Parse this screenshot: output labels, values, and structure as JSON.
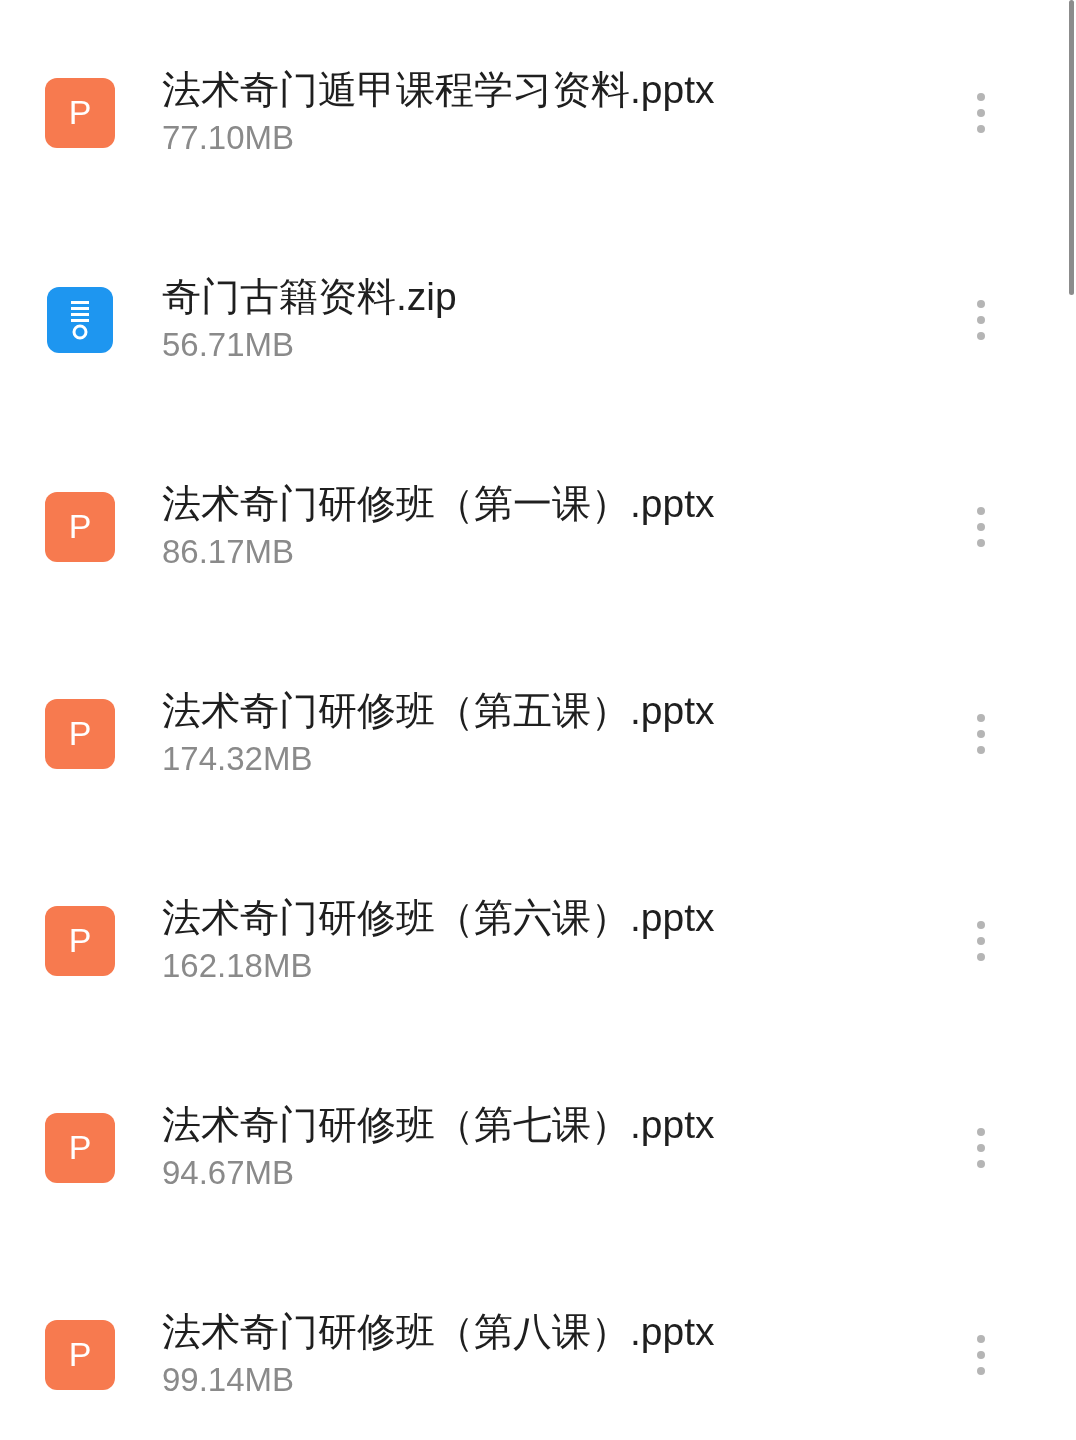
{
  "files": [
    {
      "kind": "pptx",
      "icon_letter": "P",
      "name": "法术奇门遁甲课程学习资料.pptx",
      "size": "77.10MB"
    },
    {
      "kind": "zip",
      "name": "奇门古籍资料.zip",
      "size": "56.71MB"
    },
    {
      "kind": "pptx",
      "icon_letter": "P",
      "name": "法术奇门研修班（第一课）.pptx",
      "size": "86.17MB"
    },
    {
      "kind": "pptx",
      "icon_letter": "P",
      "name": "法术奇门研修班（第五课）.pptx",
      "size": "174.32MB"
    },
    {
      "kind": "pptx",
      "icon_letter": "P",
      "name": "法术奇门研修班（第六课）.pptx",
      "size": "162.18MB"
    },
    {
      "kind": "pptx",
      "icon_letter": "P",
      "name": "法术奇门研修班（第七课）.pptx",
      "size": "94.67MB"
    },
    {
      "kind": "pptx",
      "icon_letter": "P",
      "name": "法术奇门研修班（第八课）.pptx",
      "size": "99.14MB"
    }
  ]
}
